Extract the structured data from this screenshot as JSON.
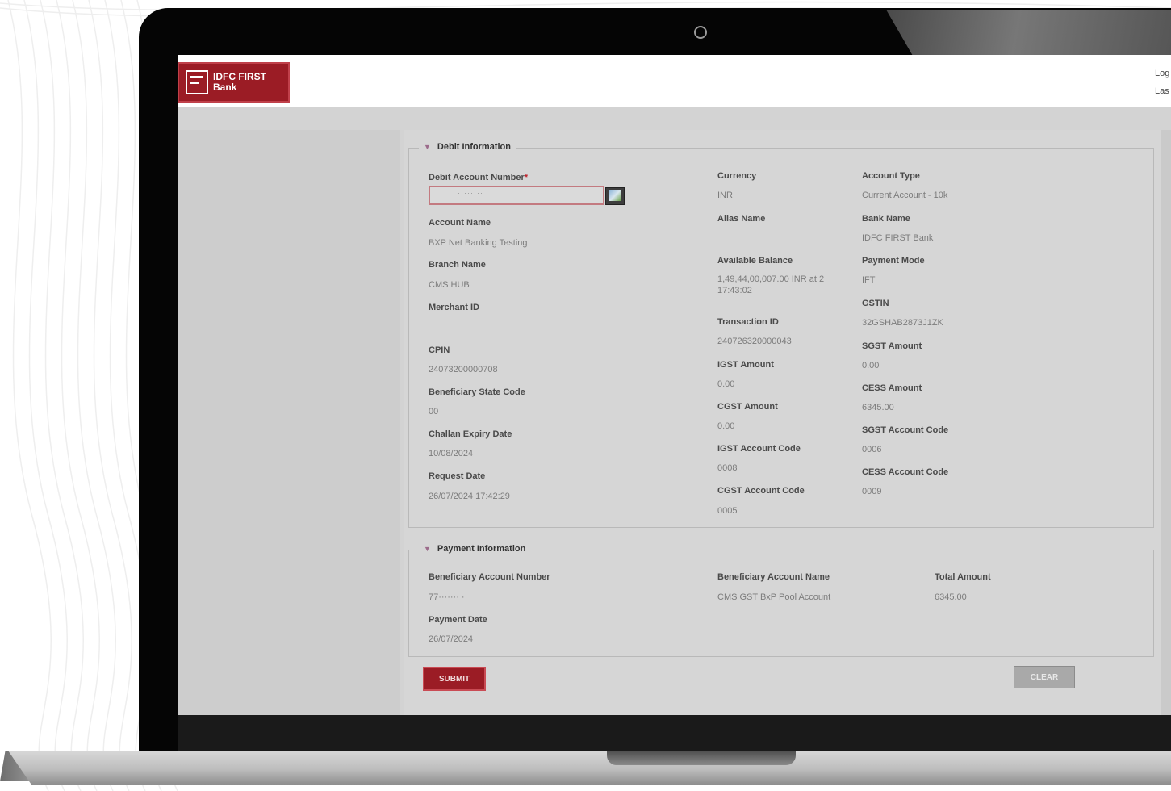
{
  "brand": {
    "logo_line1": "IDFC FIRST",
    "logo_line2": "Bank"
  },
  "header": {
    "right_line1": "Log",
    "right_line2": "Las"
  },
  "debit": {
    "legend": "Debit Information",
    "account_number_label": "Debit Account Number",
    "account_number_value": "········",
    "currency_label": "Currency",
    "currency_value": "INR",
    "account_type_label": "Account Type",
    "account_type_value": "Current Account - 10k",
    "account_name_label": "Account Name",
    "account_name_value": "BXP Net Banking Testing",
    "alias_name_label": "Alias Name",
    "bank_name_label": "Bank Name",
    "bank_name_value": "IDFC FIRST Bank",
    "branch_name_label": "Branch Name",
    "branch_name_value": "CMS HUB",
    "available_balance_label": "Available Balance",
    "available_balance_line1": "1,49,44,00,007.00 INR at 2",
    "available_balance_line2": "17:43:02",
    "payment_mode_label": "Payment Mode",
    "payment_mode_value": "IFT",
    "merchant_id_label": "Merchant ID",
    "gstin_label": "GSTIN",
    "gstin_value": "32GSHAB2873J1ZK",
    "transaction_id_label": "Transaction ID",
    "transaction_id_value": "240726320000043",
    "cpin_label": "CPIN",
    "cpin_value": "24073200000708",
    "sgst_amount_label": "SGST Amount",
    "sgst_amount_value": "0.00",
    "igst_amount_label": "IGST Amount",
    "igst_amount_value": "0.00",
    "beneficiary_state_code_label": "Beneficiary State Code",
    "beneficiary_state_code_value": "00",
    "cess_amount_label": "CESS Amount",
    "cess_amount_value": "6345.00",
    "cgst_amount_label": "CGST Amount",
    "cgst_amount_value": "0.00",
    "challan_expiry_label": "Challan Expiry Date",
    "challan_expiry_value": "10/08/2024",
    "sgst_account_code_label": "SGST Account Code",
    "sgst_account_code_value": "0006",
    "igst_account_code_label": "IGST Account Code",
    "igst_account_code_value": "0008",
    "request_date_label": "Request Date",
    "request_date_value": "26/07/2024 17:42:29",
    "cess_account_code_label": "CESS Account Code",
    "cess_account_code_value": "0009",
    "cgst_account_code_label": "CGST Account Code",
    "cgst_account_code_value": "0005"
  },
  "payment": {
    "legend": "Payment Information",
    "beneficiary_account_number_label": "Beneficiary Account Number",
    "beneficiary_account_number_value": "77······· ·",
    "beneficiary_account_name_label": "Beneficiary Account Name",
    "beneficiary_account_name_value": "CMS GST BxP Pool Account",
    "total_amount_label": "Total Amount",
    "total_amount_value": "6345.00",
    "payment_date_label": "Payment Date",
    "payment_date_value": "26/07/2024"
  },
  "actions": {
    "submit": "SUBMIT",
    "clear": "CLEAR"
  },
  "colors": {
    "brand_red": "#9b1c25",
    "laptop_bezel": "#050505",
    "screen_bg": "#d3d3d3"
  }
}
